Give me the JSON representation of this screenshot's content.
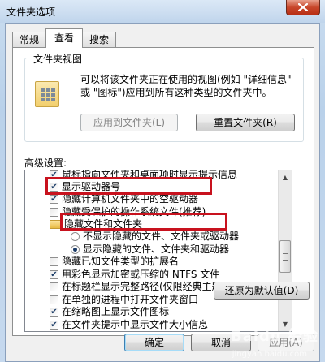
{
  "window": {
    "title": "文件夹选项"
  },
  "tabs": [
    {
      "label": "常规",
      "active": false
    },
    {
      "label": "查看",
      "active": true
    },
    {
      "label": "搜索",
      "active": false
    }
  ],
  "folder_views": {
    "legend": "文件夹视图",
    "description": "可以将该文件夹正在使用的视图(例如 \"详细信息\" 或 \"图标\")应用到所有这种类型的文件夹中。",
    "apply_button": "应用到文件夹(L)",
    "reset_button": "重置文件夹(R)"
  },
  "advanced": {
    "label": "高级设置:",
    "items": [
      {
        "type": "checkbox",
        "checked": true,
        "label": "鼠标指向文件夹和桌面项时显示提示信息"
      },
      {
        "type": "checkbox",
        "checked": true,
        "label": "显示驱动器号"
      },
      {
        "type": "checkbox",
        "checked": true,
        "label": "隐藏计算机文件夹中的空驱动器"
      },
      {
        "type": "checkbox",
        "checked": false,
        "label": "隐藏受保护的操作系统文件(推荐)"
      },
      {
        "type": "folder",
        "label": "隐藏文件和文件夹"
      },
      {
        "type": "radio",
        "checked": false,
        "label": "不显示隐藏的文件、文件夹或驱动器"
      },
      {
        "type": "radio",
        "checked": true,
        "label": "显示隐藏的文件、文件夹和驱动器"
      },
      {
        "type": "checkbox",
        "checked": false,
        "label": "隐藏已知文件类型的扩展名"
      },
      {
        "type": "checkbox",
        "checked": true,
        "label": "用彩色显示加密或压缩的 NTFS 文件"
      },
      {
        "type": "checkbox",
        "checked": false,
        "label": "在标题栏显示完整路径(仅限经典主题)"
      },
      {
        "type": "checkbox",
        "checked": false,
        "label": "在单独的进程中打开文件夹窗口"
      },
      {
        "type": "checkbox",
        "checked": true,
        "label": "在缩略图上显示文件图标"
      },
      {
        "type": "checkbox",
        "checked": true,
        "label": "在文件夹提示中显示文件大小信息"
      }
    ]
  },
  "restore_button": "还原为默认值(D)",
  "ok_button": "确定",
  "cancel_button": "取消",
  "apply_button": "应用(A)",
  "watermark": {
    "brand": "Baidu 经验",
    "url": "jingyan.baidu.com"
  },
  "icons": {
    "close": "close-icon",
    "check": "check-icon"
  },
  "colors": {
    "highlight": "#c8121e",
    "title_bar": "#c0d5ec"
  }
}
